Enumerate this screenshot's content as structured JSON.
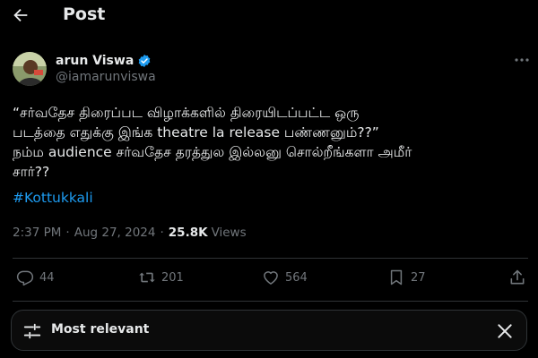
{
  "header": {
    "title": "Post"
  },
  "author": {
    "display_name": "arun Viswa",
    "handle": "@iamarunviswa",
    "verified": true
  },
  "tweet": {
    "lines": [
      "“சர்வதேச திரைப்பட விழாக்களில் திரையிடப்பட்ட ஒரு",
      "படத்தை எதுக்கு இங்க theatre la release பண்ணனும்??”",
      "நம்ம audience சர்வதேச தரத்துல இல்லனு சொல்றீங்களா அமீர்",
      "சார்??"
    ],
    "hashtag": "#Kottukkali"
  },
  "meta": {
    "time": "2:37 PM",
    "separator": "·",
    "date": "Aug 27, 2024",
    "views_count": "25.8K",
    "views_label": "Views"
  },
  "actions": {
    "replies": "44",
    "reposts": "201",
    "likes": "564",
    "bookmarks": "27"
  },
  "sort": {
    "label": "Most relevant"
  },
  "colors": {
    "background": "#000000",
    "text": "#e7e9ea",
    "muted": "#71767b",
    "accent": "#1d9bf0",
    "border": "#2f3336"
  },
  "icons": [
    "back-arrow-icon",
    "verified-badge-icon",
    "more-icon",
    "reply-icon",
    "repost-icon",
    "like-icon",
    "bookmark-icon",
    "share-icon",
    "sort-sliders-icon",
    "close-icon"
  ]
}
